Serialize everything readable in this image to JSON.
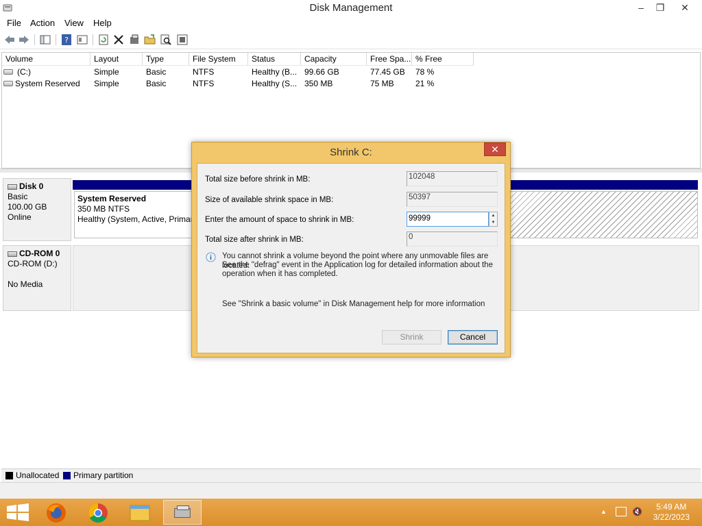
{
  "window": {
    "title": "Disk Management",
    "min_label": "–",
    "max_label": "❐",
    "close_label": "✕"
  },
  "menu": {
    "file": "File",
    "action": "Action",
    "view": "View",
    "help": "Help"
  },
  "toolbar": {
    "icons": [
      "back-arrow-icon",
      "forward-arrow-icon",
      "console-tree-icon",
      "help-icon",
      "properties-icon",
      "refresh-icon",
      "delete-icon",
      "settings-icon",
      "open-folder-icon",
      "search-icon",
      "tasks-icon"
    ]
  },
  "volume_list": {
    "columns": [
      "Volume",
      "Layout",
      "Type",
      "File System",
      "Status",
      "Capacity",
      "Free Spa...",
      "% Free"
    ],
    "rows": [
      {
        "volume": "(C:)",
        "layout": "Simple",
        "type": "Basic",
        "fs": "NTFS",
        "status": "Healthy (B...",
        "capacity": "99.66 GB",
        "free": "77.45 GB",
        "pct": "78 %"
      },
      {
        "volume": "System Reserved",
        "layout": "Simple",
        "type": "Basic",
        "fs": "NTFS",
        "status": "Healthy (S...",
        "capacity": "350 MB",
        "free": "75 MB",
        "pct": "21 %"
      }
    ]
  },
  "disk_map": {
    "disk0": {
      "name": "Disk 0",
      "type": "Basic",
      "size": "100.00 GB",
      "state": "Online"
    },
    "partition0": {
      "name": "System Reserved",
      "size_fs": "350 MB NTFS",
      "status": "Healthy (System, Active, Primar"
    },
    "cdrom0": {
      "name": "CD-ROM 0",
      "drive": "CD-ROM (D:)",
      "media": "No Media"
    }
  },
  "legend": {
    "unallocated": "Unallocated",
    "primary": "Primary partition",
    "colors": {
      "unallocated": "#000000",
      "primary": "#000080"
    }
  },
  "dialog": {
    "title": "Shrink C:",
    "close_label": "✕",
    "label_total_before": "Total size before shrink in MB:",
    "value_total_before": "102048",
    "label_available": "Size of available shrink space in MB:",
    "value_available": "50397",
    "label_amount": "Enter the amount of space to shrink in MB:",
    "value_amount": "99999",
    "label_total_after": "Total size after shrink in MB:",
    "value_total_after": "0",
    "info_line1": "You cannot shrink a volume beyond the point where any unmovable files are located.",
    "info_line2": "See the \"defrag\" event in the Application log for detailed information about the",
    "info_line3": "operation when it has completed.",
    "help_text": "See \"Shrink a basic volume\" in Disk Management help for more information",
    "shrink_button": "Shrink",
    "cancel_button": "Cancel"
  },
  "taskbar": {
    "apps": [
      "start-icon",
      "firefox-icon",
      "chrome-icon",
      "file-explorer-icon",
      "disk-management-icon"
    ],
    "time": "5:49 AM",
    "date": "3/22/2023"
  }
}
